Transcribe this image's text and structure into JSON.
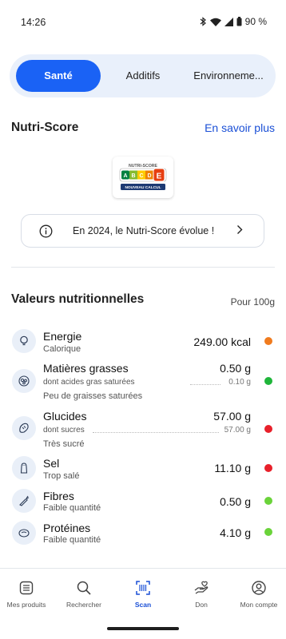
{
  "status_bar": {
    "time": "14:26",
    "battery": "90 %"
  },
  "tabs": [
    {
      "label": "Santé",
      "active": true
    },
    {
      "label": "Additifs",
      "active": false
    },
    {
      "label": "Environneme...",
      "active": false
    }
  ],
  "nutriscore": {
    "title": "Nutri-Score",
    "link": "En savoir plus",
    "logo_heading": "NUTRI-SCORE",
    "grades": [
      "A",
      "B",
      "C",
      "D",
      "E"
    ],
    "selected_grade": "E",
    "logo_caption": "NOUVEAU CALCUL",
    "info_text": "En 2024, le Nutri-Score évolue !"
  },
  "nutrition": {
    "title": "Valeurs nutritionnelles",
    "per": "Pour 100g",
    "items": [
      {
        "name": "Energie",
        "desc": "Calorique",
        "value": "249.00 kcal",
        "level": "orange",
        "icon": "lightbulb-icon"
      },
      {
        "name": "Matières grasses",
        "sub_label": "dont acides gras saturées",
        "sub_value": "0.10 g",
        "desc": "Peu de graisses saturées",
        "value": "0.50 g",
        "level": "green",
        "icon": "fat-cells-icon"
      },
      {
        "name": "Glucides",
        "sub_label": "dont sucres",
        "sub_value": "57.00 g",
        "desc": "Très sucré",
        "value": "57.00 g",
        "level": "red",
        "icon": "bread-icon"
      },
      {
        "name": "Sel",
        "desc": "Trop salé",
        "value": "11.10 g",
        "level": "red",
        "icon": "salt-shaker-icon"
      },
      {
        "name": "Fibres",
        "desc": "Faible quantité",
        "value": "0.50 g",
        "level": "light-green",
        "icon": "carrot-icon"
      },
      {
        "name": "Protéines",
        "desc": "Faible quantité",
        "value": "4.10 g",
        "level": "light-green",
        "icon": "steak-icon"
      }
    ]
  },
  "bottom_nav": [
    {
      "label": "Mes produits",
      "icon": "list-icon",
      "active": false
    },
    {
      "label": "Rechercher",
      "icon": "search-icon",
      "active": false
    },
    {
      "label": "Scan",
      "icon": "barcode-scan-icon",
      "active": true
    },
    {
      "label": "Don",
      "icon": "donate-hand-icon",
      "active": false
    },
    {
      "label": "Mon compte",
      "icon": "account-icon",
      "active": false
    }
  ],
  "colors": {
    "accent": "#1a62f5",
    "link": "#1a4fd6",
    "orange": "#f07b1e",
    "green": "#1fb53a",
    "red": "#e8202a",
    "light-green": "#6ad33a",
    "ns_a": "#038141",
    "ns_b": "#85bb2f",
    "ns_c": "#fecb02",
    "ns_d": "#ee8100",
    "ns_e": "#e63e11"
  }
}
